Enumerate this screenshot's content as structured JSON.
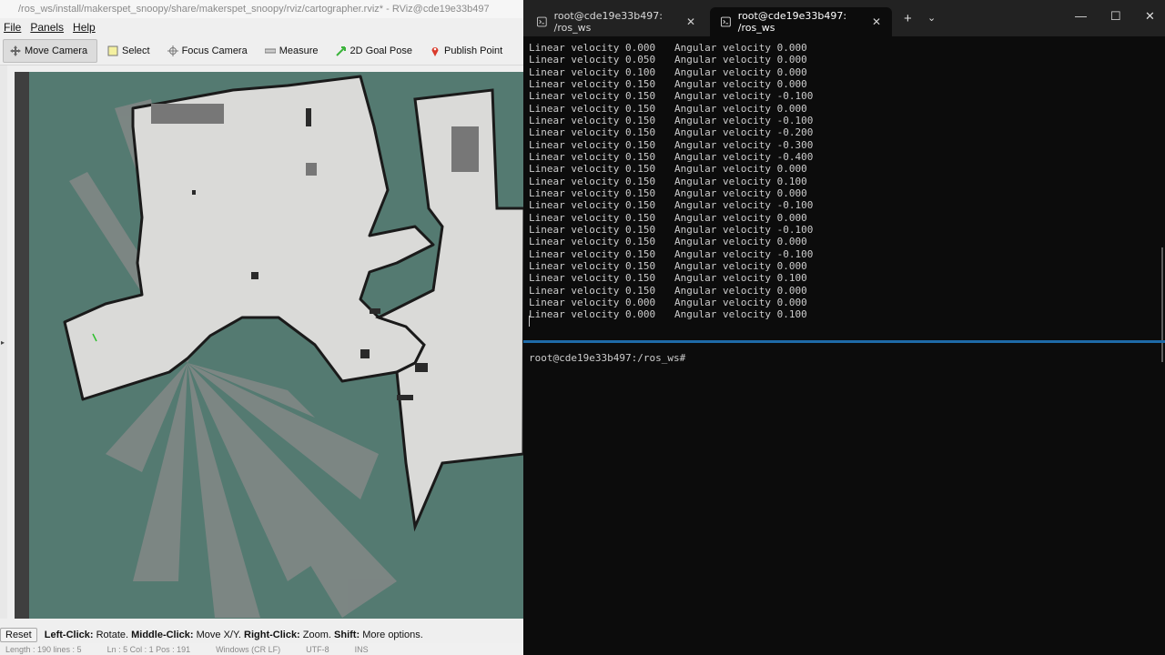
{
  "rviz": {
    "title": "/ros_ws/install/makerspet_snoopy/share/makerspet_snoopy/rviz/cartographer.rviz* - RViz@cde19e33b497",
    "menu": [
      {
        "label": "File"
      },
      {
        "label": "Panels"
      },
      {
        "label": "Help"
      }
    ],
    "toolbar": [
      {
        "name": "move-camera",
        "label": "Move Camera",
        "icon": "move-camera-icon",
        "active": true
      },
      {
        "name": "select",
        "label": "Select",
        "icon": "select-icon"
      },
      {
        "name": "focus-camera",
        "label": "Focus Camera",
        "icon": "focus-camera-icon"
      },
      {
        "name": "measure",
        "label": "Measure",
        "icon": "measure-icon"
      },
      {
        "name": "2d-goal-pose",
        "label": "2D Goal Pose",
        "icon": "goal-pose-icon"
      },
      {
        "name": "publish-point",
        "label": "Publish Point",
        "icon": "publish-point-icon"
      }
    ],
    "status": {
      "reset_label": "Reset",
      "hint_parts": [
        {
          "text": "Left-Click:",
          "bold": true
        },
        {
          "text": " Rotate. ",
          "bold": false
        },
        {
          "text": "Middle-Click:",
          "bold": true
        },
        {
          "text": " Move X/Y. ",
          "bold": false
        },
        {
          "text": "Right-Click:",
          "bold": true
        },
        {
          "text": " Zoom. ",
          "bold": false
        },
        {
          "text": "Shift:",
          "bold": true
        },
        {
          "text": " More options.",
          "bold": false
        }
      ]
    },
    "bottom_ghost": [
      "Length : 190   lines : 5",
      "Ln : 5   Col : 1   Pos : 191",
      "Windows (CR LF)",
      "UTF-8",
      "INS"
    ],
    "colors": {
      "map_background": "#547a71",
      "map_free": "#dadad8"
    }
  },
  "terminal": {
    "tabs": [
      {
        "label": "root@cde19e33b497: /ros_ws",
        "active": false
      },
      {
        "label": "root@cde19e33b497: /ros_ws",
        "active": true
      }
    ],
    "new_tab_label": "+",
    "dropdown_label": "⌄",
    "window_controls": {
      "minimize": "—",
      "maximize": "☐",
      "close": "✕"
    },
    "pane1_lines": [
      {
        "linear": "Linear velocity 0.000",
        "angular": "Angular velocity 0.000"
      },
      {
        "linear": "Linear velocity 0.050",
        "angular": "Angular velocity 0.000"
      },
      {
        "linear": "Linear velocity 0.100",
        "angular": "Angular velocity 0.000"
      },
      {
        "linear": "Linear velocity 0.150",
        "angular": "Angular velocity 0.000"
      },
      {
        "linear": "Linear velocity 0.150",
        "angular": "Angular velocity -0.100"
      },
      {
        "linear": "Linear velocity 0.150",
        "angular": "Angular velocity 0.000"
      },
      {
        "linear": "Linear velocity 0.150",
        "angular": "Angular velocity -0.100"
      },
      {
        "linear": "Linear velocity 0.150",
        "angular": "Angular velocity -0.200"
      },
      {
        "linear": "Linear velocity 0.150",
        "angular": "Angular velocity -0.300"
      },
      {
        "linear": "Linear velocity 0.150",
        "angular": "Angular velocity -0.400"
      },
      {
        "linear": "Linear velocity 0.150",
        "angular": "Angular velocity 0.000"
      },
      {
        "linear": "Linear velocity 0.150",
        "angular": "Angular velocity 0.100"
      },
      {
        "linear": "Linear velocity 0.150",
        "angular": "Angular velocity 0.000"
      },
      {
        "linear": "Linear velocity 0.150",
        "angular": "Angular velocity -0.100"
      },
      {
        "linear": "Linear velocity 0.150",
        "angular": "Angular velocity 0.000"
      },
      {
        "linear": "Linear velocity 0.150",
        "angular": "Angular velocity -0.100"
      },
      {
        "linear": "Linear velocity 0.150",
        "angular": "Angular velocity 0.000"
      },
      {
        "linear": "Linear velocity 0.150",
        "angular": "Angular velocity -0.100"
      },
      {
        "linear": "Linear velocity 0.150",
        "angular": "Angular velocity 0.000"
      },
      {
        "linear": "Linear velocity 0.150",
        "angular": "Angular velocity 0.100"
      },
      {
        "linear": "Linear velocity 0.150",
        "angular": "Angular velocity 0.000"
      },
      {
        "linear": "Linear velocity 0.000",
        "angular": "Angular velocity 0.000"
      },
      {
        "linear": "Linear velocity 0.000",
        "angular": "Angular velocity 0.100"
      }
    ],
    "pane2_prompt": "root@cde19e33b497:/ros_ws#",
    "colors": {
      "background": "#0c0c0c",
      "text": "#cccccc",
      "pane_divider": "#1e6aa8"
    }
  }
}
